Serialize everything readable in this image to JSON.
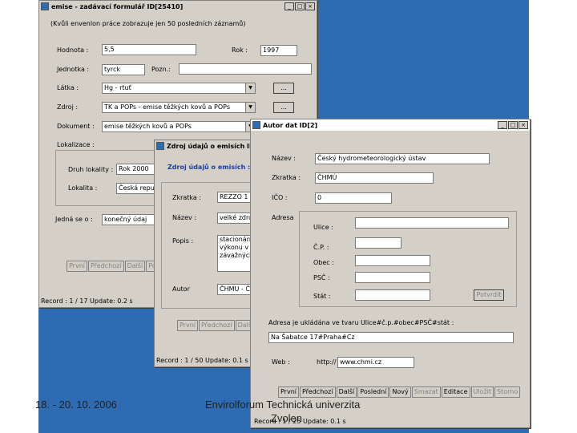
{
  "main_window": {
    "title": "emise - zadávací formulář ID[25410]",
    "notice": "(Kvůli envenlon práce zobrazuje jen 50 posledních záznamů)",
    "labels": {
      "hodnota": "Hodnota :",
      "rok": "Rok :",
      "jednotka": "Jednotka :",
      "pozn": "Pozn.:",
      "latka": "Látka :",
      "zdroj": "Zdroj :",
      "dokument": "Dokument :",
      "lokalizace": "Lokalizace :",
      "druh_lokality": "Druh lokality :",
      "lokalita": "Lokalita :",
      "jedna_se_o": "Jedná se o :"
    },
    "values": {
      "hodnota": "5,5",
      "rok": "1997",
      "jednotka": "tyrck",
      "pozn": "",
      "latka": "Hg - rtuť",
      "zdroj": "TK a POPs - emise těžkých kovů a POPs",
      "dokument": "emise těžkých kovů a POPs",
      "druh_lokality": "Rok 2000",
      "lokalita": "Česká repu",
      "jedna_se_o": "konečný údaj"
    },
    "ellipsis_label": "...",
    "nav_buttons": [
      "První",
      "Předchozí",
      "Další",
      "Pos"
    ],
    "status": "Record : 1 / 17  Update: 0.2 s"
  },
  "source_window": {
    "title": "Zdroj údajů o emisích ID",
    "heading": "Zdroj údajů o emisích :",
    "labels": {
      "zkratka": "Zkratka :",
      "nazev": "Název :",
      "popis": "Popis :",
      "autor": "Autor"
    },
    "values": {
      "zkratka": "REZZO 1",
      "nazev": "velké zdro",
      "popis": "stacionární\nvýkonu v\nzávažných",
      "autor": "ČHMU - Č"
    },
    "nav_buttons": [
      "První",
      "Předchozí",
      "Další"
    ],
    "status": "Record : 1 / 50  Update: 0.1 s"
  },
  "author_window": {
    "title": "Autor dat ID[2]",
    "labels": {
      "nazev": "Název :",
      "zkratka": "Zkratka :",
      "ico": "IČO :",
      "adresa": "Adresa",
      "ulice": "Ulice :",
      "cp": "Č.P. :",
      "obec": "Obec :",
      "psc": "PSČ :",
      "stat": "Stát :",
      "format": "Adresa je ukládána ve tvaru Ulice#č.p.#obec#PSČ#stát :",
      "web": "Web :"
    },
    "values": {
      "nazev": "Český hydrometeorologický ústav",
      "zkratka": "ČHMÚ",
      "ico": "0",
      "ulice": "",
      "cp": "",
      "obec": "",
      "psc": "",
      "stat": "",
      "adresa_raw": "Na Šabatce 17#Praha#Cz",
      "web_prefix": "http://",
      "web": "www.chmi.cz"
    },
    "potvrdit_label": "Potvrdit",
    "nav_buttons": [
      "První",
      "Předchozí",
      "Další",
      "Poslední",
      "Nový",
      "Smazat",
      "Editace",
      "Uložit",
      "Storno"
    ],
    "status": "Record : 1 / 25  Update: 0.1 s"
  },
  "footer": {
    "date": "18. - 20. 10. 2006",
    "venue_line1": "Envirolforum Technická univerzita",
    "venue_line2": "Zvolen"
  },
  "colors": {
    "desktop": "#2d6bb3",
    "window": "#d4d0c8",
    "heading": "#1a3ea8"
  }
}
